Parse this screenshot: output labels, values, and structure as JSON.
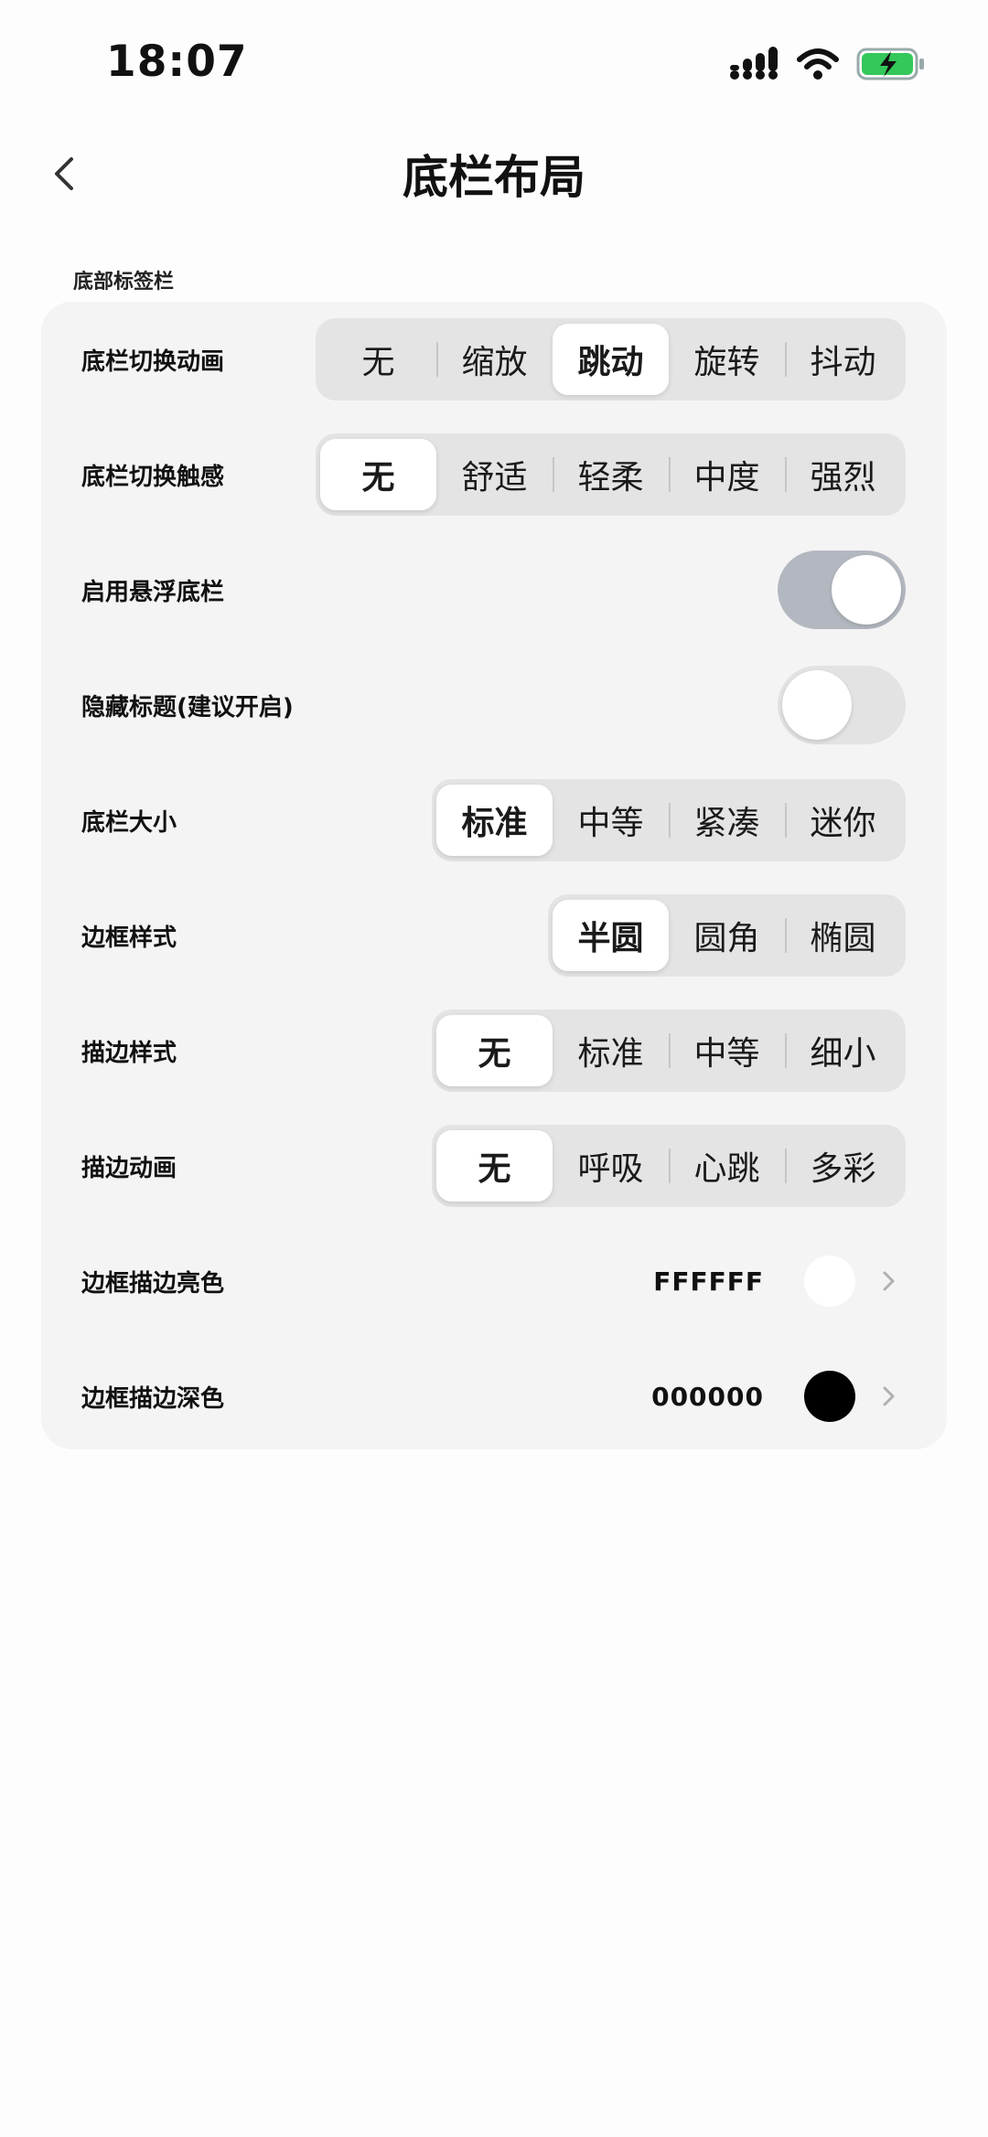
{
  "status_bar": {
    "time": "18:07"
  },
  "header": {
    "title": "底栏布局"
  },
  "section": {
    "label": "底部标签栏"
  },
  "settings": {
    "switch_animation": {
      "label": "底栏切换动画",
      "options": [
        "无",
        "缩放",
        "跳动",
        "旋转",
        "抖动"
      ],
      "selected": "跳动"
    },
    "switch_haptic": {
      "label": "底栏切换触感",
      "options": [
        "无",
        "舒适",
        "轻柔",
        "中度",
        "强烈"
      ],
      "selected": "无"
    },
    "floating_bar": {
      "label": "启用悬浮底栏",
      "enabled": true
    },
    "hide_title": {
      "label": "隐藏标题(建议开启)",
      "enabled": false
    },
    "bar_size": {
      "label": "底栏大小",
      "options": [
        "标准",
        "中等",
        "紧凑",
        "迷你"
      ],
      "selected": "标准"
    },
    "border_style": {
      "label": "边框样式",
      "options": [
        "半圆",
        "圆角",
        "椭圆"
      ],
      "selected": "半圆"
    },
    "stroke_style": {
      "label": "描边样式",
      "options": [
        "无",
        "标准",
        "中等",
        "细小"
      ],
      "selected": "无"
    },
    "stroke_animation": {
      "label": "描边动画",
      "options": [
        "无",
        "呼吸",
        "心跳",
        "多彩"
      ],
      "selected": "无"
    },
    "stroke_light_color": {
      "label": "边框描边亮色",
      "value": "FFFFFF",
      "swatch": "#ffffff"
    },
    "stroke_dark_color": {
      "label": "边框描边深色",
      "value": "000000",
      "swatch": "#000000"
    }
  },
  "colors": {
    "battery": "#34c759",
    "toggle_on": "#b3b8c0",
    "toggle_off": "#e3e3e3"
  }
}
